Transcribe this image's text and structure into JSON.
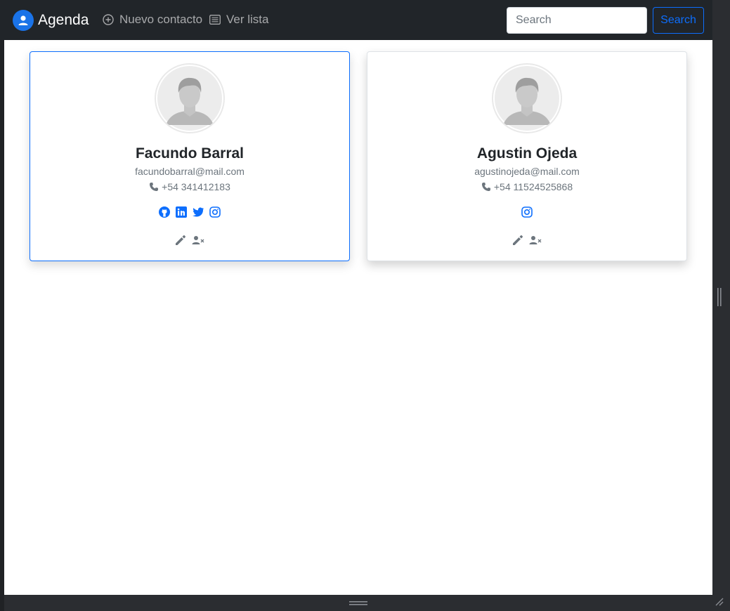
{
  "navbar": {
    "brand": "Agenda",
    "new_contact": "Nuevo contacto",
    "list_view": "Ver lista",
    "search_placeholder": "Search",
    "search_button": "Search"
  },
  "contacts": [
    {
      "name": "Facundo Barral",
      "email": "facundobarral@mail.com",
      "phone": "+54 341412183",
      "socials": [
        "github-icon",
        "linkedin-icon",
        "twitter-icon",
        "instagram-icon"
      ],
      "selected": true
    },
    {
      "name": "Agustin Ojeda",
      "email": "agustinojeda@mail.com",
      "phone": "+54 11524525868",
      "socials": [
        "instagram-icon"
      ],
      "selected": false
    }
  ],
  "colors": {
    "navbar_bg": "#212529",
    "accent": "#0d6efd",
    "brand_icon": "#1a73e8",
    "muted_text": "#6c757d"
  }
}
